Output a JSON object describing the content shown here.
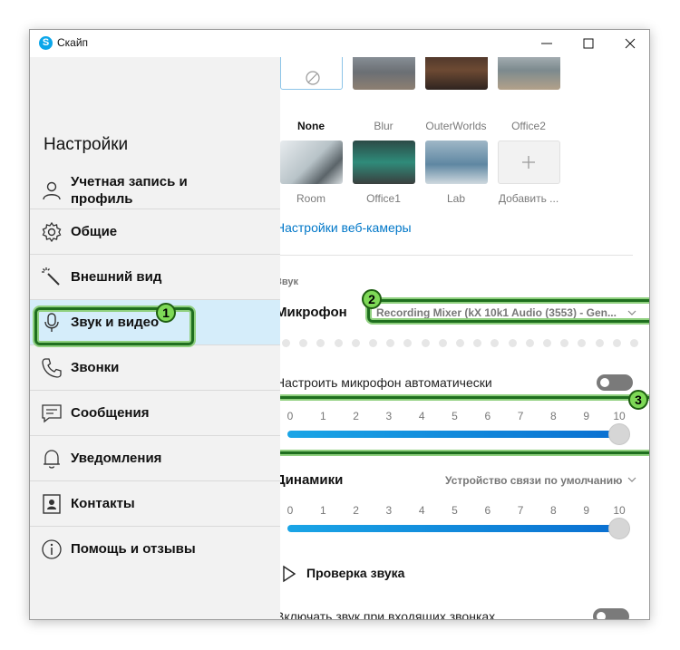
{
  "window": {
    "title": "Скайп"
  },
  "sidebar": {
    "heading": "Настройки",
    "items": [
      {
        "label": "Учетная запись и профиль",
        "icon": "person-icon"
      },
      {
        "label": "Общие",
        "icon": "gear-icon"
      },
      {
        "label": "Внешний вид",
        "icon": "magic-wand-icon"
      },
      {
        "label": "Звук и видео",
        "icon": "microphone-icon",
        "active": true
      },
      {
        "label": "Звонки",
        "icon": "phone-icon"
      },
      {
        "label": "Сообщения",
        "icon": "chat-icon"
      },
      {
        "label": "Уведомления",
        "icon": "bell-icon"
      },
      {
        "label": "Контакты",
        "icon": "contacts-icon"
      },
      {
        "label": "Помощь и отзывы",
        "icon": "info-icon"
      }
    ]
  },
  "backgrounds": {
    "row1": [
      "None",
      "Blur",
      "OuterWorlds",
      "Office2"
    ],
    "row2": [
      "Room",
      "Office1",
      "Lab",
      "Добавить ..."
    ],
    "selected": "None"
  },
  "webcam_settings_link": "Настройки веб-камеры",
  "audio": {
    "section_label": "Звук",
    "microphone": {
      "label": "Микрофон",
      "device": "Recording Mixer (kX 10k1 Audio (3553) - Gen...",
      "auto_adjust_label": "Настроить микрофон автоматически",
      "auto_adjust": false,
      "level": 10
    },
    "speakers": {
      "label": "Динамики",
      "device": "Устройство связи по умолчанию",
      "level": 10
    },
    "scale": [
      "0",
      "1",
      "2",
      "3",
      "4",
      "5",
      "6",
      "7",
      "8",
      "9",
      "10"
    ],
    "test_sound_label": "Проверка звука",
    "incoming_calls_label": "Включать звук при входящих звонках",
    "incoming_calls": false
  },
  "annotations": [
    "1",
    "2",
    "3"
  ],
  "colors": {
    "accent": "#0077c8",
    "active_nav": "#d5edfa",
    "highlight": "#1f6f1f",
    "badge": "#7ed957"
  }
}
